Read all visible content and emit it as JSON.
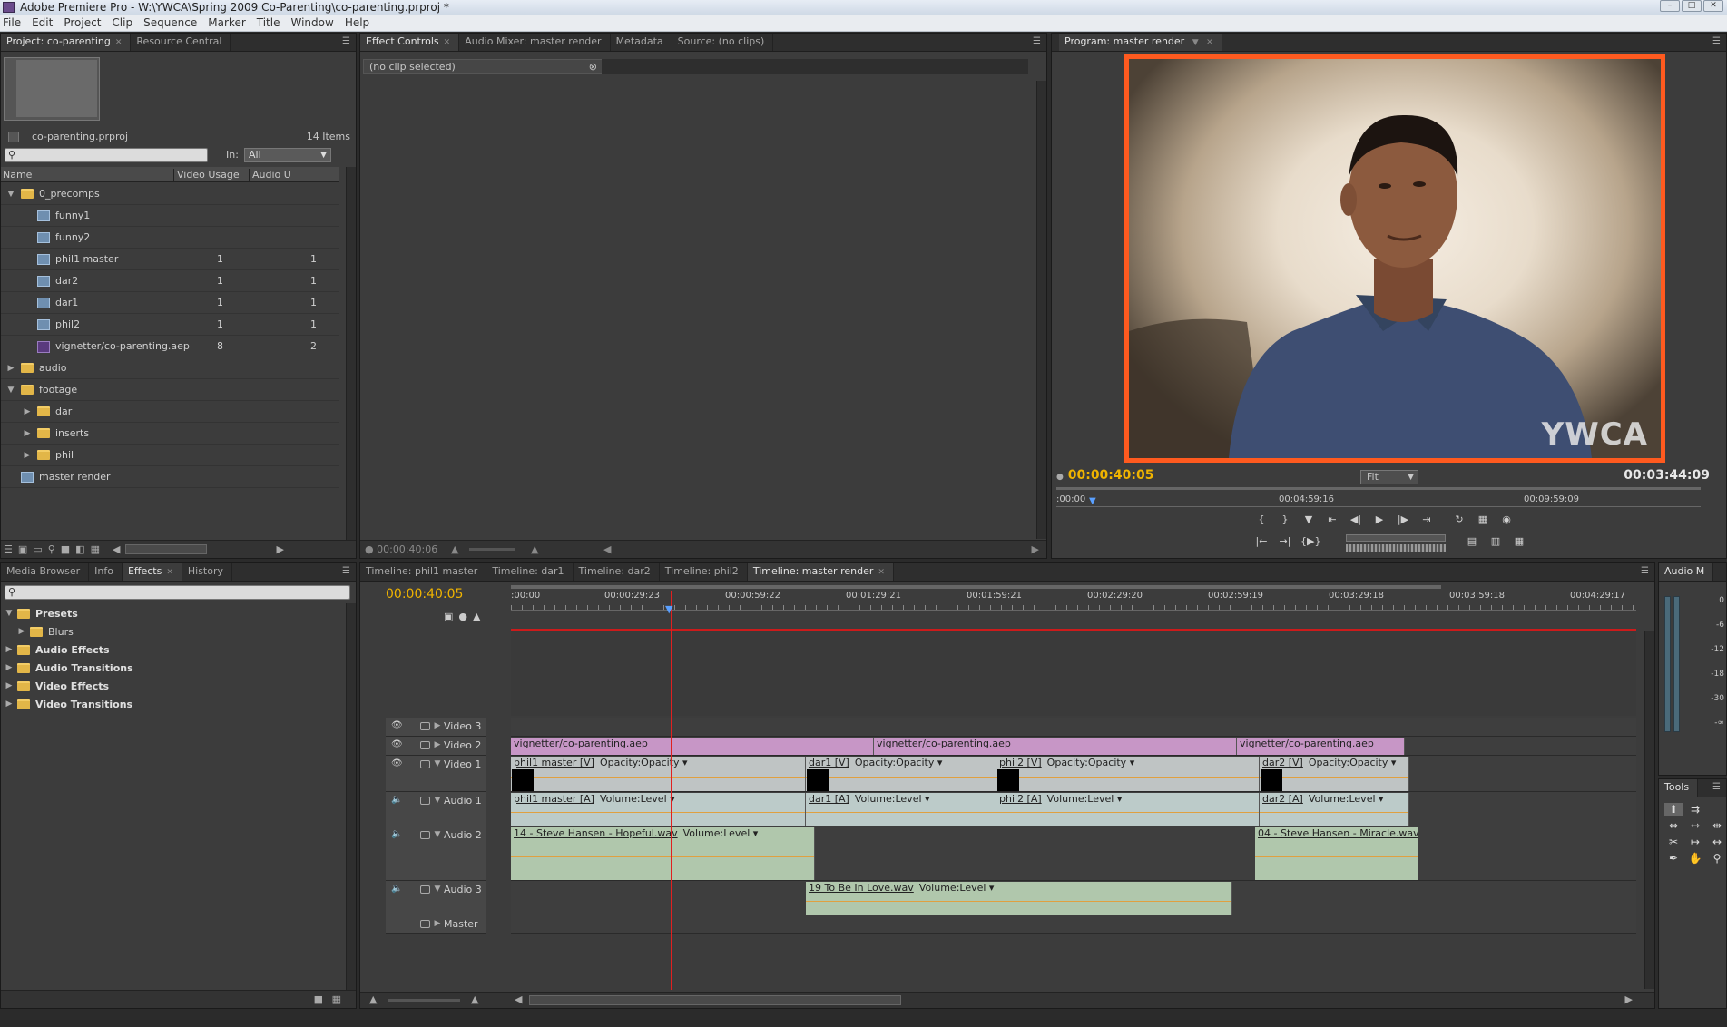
{
  "window": {
    "title": "Adobe Premiere Pro - W:\\YWCA\\Spring 2009 Co-Parenting\\co-parenting.prproj *"
  },
  "menu": [
    "File",
    "Edit",
    "Project",
    "Clip",
    "Sequence",
    "Marker",
    "Title",
    "Window",
    "Help"
  ],
  "project_panel": {
    "tabs": [
      {
        "label": "Project: co-parenting",
        "active": true
      },
      {
        "label": "Resource Central",
        "active": false
      }
    ],
    "project_file": "co-parenting.prproj",
    "items_count": "14 Items",
    "search_placeholder": "",
    "in_label": "In:",
    "in_value": "All",
    "columns": [
      "Name",
      "Video Usage",
      "Audio U"
    ],
    "items": [
      {
        "name": "0_precomps",
        "type": "folder",
        "level": 0,
        "expanded": true,
        "video": "",
        "audio": ""
      },
      {
        "name": "funny1",
        "type": "sequence",
        "level": 1,
        "video": "",
        "audio": ""
      },
      {
        "name": "funny2",
        "type": "sequence",
        "level": 1,
        "video": "",
        "audio": ""
      },
      {
        "name": "phil1 master",
        "type": "sequence",
        "level": 1,
        "video": "1",
        "audio": "1"
      },
      {
        "name": "dar2",
        "type": "sequence",
        "level": 1,
        "video": "1",
        "audio": "1"
      },
      {
        "name": "dar1",
        "type": "sequence",
        "level": 1,
        "video": "1",
        "audio": "1"
      },
      {
        "name": "phil2",
        "type": "sequence",
        "level": 1,
        "video": "1",
        "audio": "1"
      },
      {
        "name": "vignetter/co-parenting.aep",
        "type": "ae",
        "level": 1,
        "video": "8",
        "audio": "2"
      },
      {
        "name": "audio",
        "type": "folder",
        "level": 0,
        "expanded": false,
        "video": "",
        "audio": ""
      },
      {
        "name": "footage",
        "type": "folder",
        "level": 0,
        "expanded": true,
        "video": "",
        "audio": ""
      },
      {
        "name": "dar",
        "type": "folder",
        "level": 1,
        "expanded": false,
        "video": "",
        "audio": ""
      },
      {
        "name": "inserts",
        "type": "folder",
        "level": 1,
        "expanded": false,
        "video": "",
        "audio": ""
      },
      {
        "name": "phil",
        "type": "folder",
        "level": 1,
        "expanded": false,
        "video": "",
        "audio": ""
      },
      {
        "name": "master render",
        "type": "sequence",
        "level": 0,
        "video": "",
        "audio": ""
      }
    ]
  },
  "effect_controls": {
    "tabs": [
      {
        "label": "Effect Controls",
        "active": true
      },
      {
        "label": "Audio Mixer: master render",
        "active": false
      },
      {
        "label": "Metadata",
        "active": false
      },
      {
        "label": "Source: (no clips)",
        "active": false
      }
    ],
    "clip_label": "(no clip selected)",
    "timecode": "00:00:40:06"
  },
  "program_monitor": {
    "tab": "Program: master render",
    "timecode": "00:00:40:05",
    "fit": "Fit",
    "duration": "00:03:44:09",
    "ruler": [
      ":00:00",
      "00:04:59:16",
      "00:09:59:09"
    ],
    "watermark": "YWCA",
    "accent": "#ff5a1f"
  },
  "effects_panel": {
    "tabs": [
      {
        "label": "Media Browser",
        "active": false
      },
      {
        "label": "Info",
        "active": false
      },
      {
        "label": "Effects",
        "active": true
      },
      {
        "label": "History",
        "active": false
      }
    ],
    "tree": [
      {
        "label": "Presets",
        "level": 0,
        "expanded": true
      },
      {
        "label": "Blurs",
        "level": 1,
        "expanded": false
      },
      {
        "label": "Audio Effects",
        "level": 0,
        "expanded": false
      },
      {
        "label": "Audio Transitions",
        "level": 0,
        "expanded": false
      },
      {
        "label": "Video Effects",
        "level": 0,
        "expanded": false
      },
      {
        "label": "Video Transitions",
        "level": 0,
        "expanded": false
      }
    ]
  },
  "timeline": {
    "tabs": [
      {
        "label": "Timeline: phil1 master",
        "active": false
      },
      {
        "label": "Timeline: dar1",
        "active": false
      },
      {
        "label": "Timeline: dar2",
        "active": false
      },
      {
        "label": "Timeline: phil2",
        "active": false
      },
      {
        "label": "Timeline: master render",
        "active": true
      }
    ],
    "timecode": "00:00:40:05",
    "ruler": [
      ":00:00",
      "00:00:29:23",
      "00:00:59:22",
      "00:01:29:21",
      "00:01:59:21",
      "00:02:29:20",
      "00:02:59:19",
      "00:03:29:18",
      "00:03:59:18",
      "00:04:29:17"
    ],
    "tracks": [
      {
        "name": "Video 3",
        "kind": "video",
        "clips": []
      },
      {
        "name": "Video 2",
        "kind": "video",
        "clips": [
          {
            "label": "vignetter/co-parenting.aep",
            "start": 0,
            "end": 0.4
          },
          {
            "label": "vignetter/co-parenting.aep",
            "start": 0.4,
            "end": 0.8
          },
          {
            "label": "vignetter/co-parenting.aep",
            "start": 0.8,
            "end": 0.985
          }
        ]
      },
      {
        "name": "Video 1",
        "kind": "video",
        "clips": [
          {
            "label": "phil1 master [V]",
            "fx": "Opacity:Opacity",
            "start": 0,
            "end": 0.325
          },
          {
            "label": "dar1 [V]",
            "fx": "Opacity:Opacity",
            "start": 0.325,
            "end": 0.535
          },
          {
            "label": "phil2 [V]",
            "fx": "Opacity:Opacity",
            "start": 0.535,
            "end": 0.825
          },
          {
            "label": "dar2 [V]",
            "fx": "Opacity:Opacity",
            "start": 0.825,
            "end": 0.99
          }
        ]
      },
      {
        "name": "Audio 1",
        "kind": "audio",
        "clips": [
          {
            "label": "phil1 master [A]",
            "fx": "Volume:Level",
            "start": 0,
            "end": 0.325
          },
          {
            "label": "dar1 [A]",
            "fx": "Volume:Level",
            "start": 0.325,
            "end": 0.535
          },
          {
            "label": "phil2 [A]",
            "fx": "Volume:Level",
            "start": 0.535,
            "end": 0.825
          },
          {
            "label": "dar2 [A]",
            "fx": "Volume:Level",
            "start": 0.825,
            "end": 0.99
          }
        ]
      },
      {
        "name": "Audio 2",
        "kind": "audio",
        "clips": [
          {
            "label": "14 - Steve Hansen - Hopeful.wav",
            "fx": "Volume:Level",
            "start": 0,
            "end": 0.335
          },
          {
            "label": "04 - Steve Hansen - Miracle.wav",
            "fx": "",
            "start": 0.82,
            "end": 1.0
          }
        ]
      },
      {
        "name": "Audio 3",
        "kind": "audio",
        "clips": [
          {
            "label": "19 To Be In Love.wav",
            "fx": "Volume:Level",
            "start": 0.325,
            "end": 0.795
          }
        ]
      },
      {
        "name": "Master",
        "kind": "master",
        "clips": []
      }
    ]
  },
  "audio_meter": {
    "title": "Audio M",
    "scale": [
      "0",
      "-6",
      "-12",
      "-18",
      "-30",
      "-∞"
    ]
  },
  "tools": {
    "title": "Tools"
  }
}
